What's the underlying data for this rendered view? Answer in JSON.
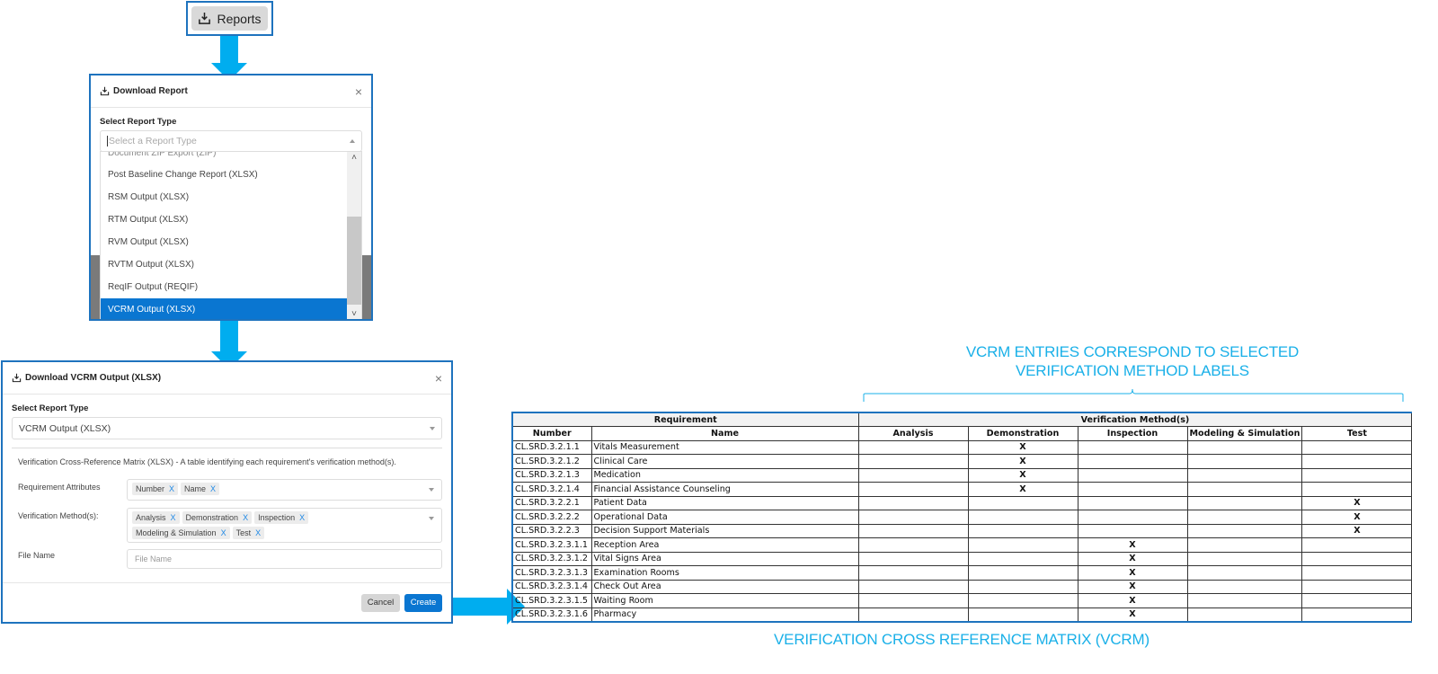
{
  "reports_button": {
    "label": "Reports",
    "icon": "download-tray-icon"
  },
  "dialog_download_report": {
    "title": "Download Report",
    "icon": "download-tray-icon",
    "close_icon": "×",
    "select_label": "Select Report Type",
    "select_placeholder": "Select a Report Type",
    "options": [
      "Document ZIP Export (ZIP)",
      "Post Baseline Change Report (XLSX)",
      "RSM Output (XLSX)",
      "RTM Output (XLSX)",
      "RVM Output (XLSX)",
      "RVTM Output (XLSX)",
      "ReqIF Output (REQIF)",
      "VCRM Output (XLSX)"
    ],
    "selected_option": "VCRM Output (XLSX)",
    "scroll_up": "⌃",
    "scroll_down": "⌄"
  },
  "dialog_download_vcrm": {
    "title": "Download VCRM Output (XLSX)",
    "icon": "download-tray-icon",
    "close_icon": "×",
    "select_label": "Select Report Type",
    "select_value": "VCRM Output (XLSX)",
    "description": "Verification Cross-Reference Matrix (XLSX)  -  A table identifying each requirement's verification method(s).",
    "requirement_attributes": {
      "label": "Requirement Attributes",
      "tags": [
        "Number",
        "Name"
      ]
    },
    "verification_methods": {
      "label": "Verification Method(s):",
      "tags": [
        "Analysis",
        "Demonstration",
        "Inspection",
        "Modeling & Simulation",
        "Test"
      ]
    },
    "file_name": {
      "label": "File Name",
      "placeholder": "File Name",
      "value": ""
    },
    "tag_remove": "X",
    "cancel_label": "Cancel",
    "create_label": "Create"
  },
  "annotations": {
    "top_line1": "VCRM ENTRIES CORRESPOND TO SELECTED",
    "top_line2": "VERIFICATION METHOD LABELS",
    "bottom": "VERIFICATION CROSS REFERENCE MATRIX (VCRM)"
  },
  "vcrm_table": {
    "group_headers": [
      "Requirement",
      "Verification Method(s)"
    ],
    "columns": [
      "Number",
      "Name",
      "Analysis",
      "Demonstration",
      "Inspection",
      "Modeling & Simulation",
      "Test"
    ],
    "mark": "X",
    "rows": [
      {
        "number": "CL.SRD.3.2.1.1",
        "name": "Vitals Measurement",
        "method": "Demonstration"
      },
      {
        "number": "CL.SRD.3.2.1.2",
        "name": "Clinical Care",
        "method": "Demonstration"
      },
      {
        "number": "CL.SRD.3.2.1.3",
        "name": "Medication",
        "method": "Demonstration"
      },
      {
        "number": "CL.SRD.3.2.1.4",
        "name": "Financial Assistance Counseling",
        "method": "Demonstration"
      },
      {
        "number": "CL.SRD.3.2.2.1",
        "name": "Patient Data",
        "method": "Test"
      },
      {
        "number": "CL.SRD.3.2.2.2",
        "name": "Operational Data",
        "method": "Test"
      },
      {
        "number": "CL.SRD.3.2.2.3",
        "name": "Decision Support Materials",
        "method": "Test"
      },
      {
        "number": "CL.SRD.3.2.3.1.1",
        "name": "Reception Area",
        "method": "Inspection"
      },
      {
        "number": "CL.SRD.3.2.3.1.2",
        "name": "Vital Signs Area",
        "method": "Inspection"
      },
      {
        "number": "CL.SRD.3.2.3.1.3",
        "name": "Examination Rooms",
        "method": "Inspection"
      },
      {
        "number": "CL.SRD.3.2.3.1.4",
        "name": "Check Out Area",
        "method": "Inspection"
      },
      {
        "number": "CL.SRD.3.2.3.1.5",
        "name": "Waiting Room",
        "method": "Inspection"
      },
      {
        "number": "CL.SRD.3.2.3.1.6",
        "name": "Pharmacy",
        "method": "Inspection"
      }
    ]
  },
  "colors": {
    "accent_arrow": "#00adef",
    "frame_blue": "#1e73be",
    "selected_blue": "#0a76d1",
    "annotation": "#1ab0e8"
  }
}
